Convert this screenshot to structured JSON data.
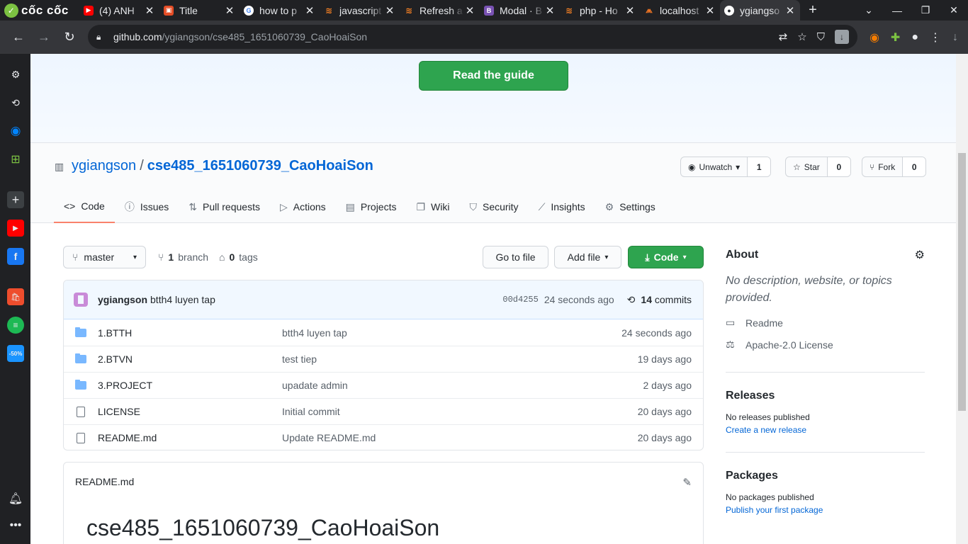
{
  "browser": {
    "brand": "cốc cốc",
    "tabs": [
      {
        "title": "(4) ANH",
        "fav": "youtube-icon",
        "color": "#ff0000"
      },
      {
        "title": "Title",
        "fav": "code-icon",
        "color": "#e44d26"
      },
      {
        "title": "how to p",
        "fav": "google-icon",
        "color": "#4285f4"
      },
      {
        "title": "javascript",
        "fav": "stackoverflow-icon",
        "color": "#f48024"
      },
      {
        "title": "Refresh a",
        "fav": "stackoverflow-icon",
        "color": "#f48024"
      },
      {
        "title": "Modal · B",
        "fav": "bootstrap-icon",
        "color": "#7952b3"
      },
      {
        "title": "php - Ho",
        "fav": "stackoverflow-icon",
        "color": "#f48024"
      },
      {
        "title": "localhost",
        "fav": "xampp-icon",
        "color": "#fb7a24"
      },
      {
        "title": "ygiangso",
        "fav": "github-icon",
        "color": "#24292e"
      }
    ],
    "url_host": "github.com",
    "url_path": "/ygiangson/cse485_1651060739_CaoHoaiSon"
  },
  "hero": {
    "button": "Read the guide"
  },
  "repo": {
    "owner": "ygiangson",
    "name": "cse485_1651060739_CaoHoaiSon",
    "watch_label": "Unwatch",
    "watch_count": "1",
    "star_label": "Star",
    "star_count": "0",
    "fork_label": "Fork",
    "fork_count": "0"
  },
  "nav": {
    "code": "Code",
    "issues": "Issues",
    "pulls": "Pull requests",
    "actions": "Actions",
    "projects": "Projects",
    "wiki": "Wiki",
    "security": "Security",
    "insights": "Insights",
    "settings": "Settings"
  },
  "files_bar": {
    "branch": "master",
    "branch_count": "1",
    "branch_label": "branch",
    "tag_count": "0",
    "tag_label": "tags",
    "goto": "Go to file",
    "add": "Add file",
    "code": "Code"
  },
  "commit": {
    "author": "ygiangson",
    "message": "btth4 luyen tap",
    "sha": "00d4255",
    "age": "24 seconds ago",
    "count": "14",
    "count_label": "commits"
  },
  "files": [
    {
      "type": "folder",
      "name": "1.BTTH",
      "message": "btth4 luyen tap",
      "age": "24 seconds ago"
    },
    {
      "type": "folder",
      "name": "2.BTVN",
      "message": "test tiep",
      "age": "19 days ago"
    },
    {
      "type": "folder",
      "name": "3.PROJECT",
      "message": "upadate admin",
      "age": "2 days ago"
    },
    {
      "type": "file",
      "name": "LICENSE",
      "message": "Initial commit",
      "age": "20 days ago"
    },
    {
      "type": "file",
      "name": "README.md",
      "message": "Update README.md",
      "age": "20 days ago"
    }
  ],
  "readme": {
    "filename": "README.md",
    "heading": "cse485_1651060739_CaoHoaiSon"
  },
  "about": {
    "title": "About",
    "description": "No description, website, or topics provided.",
    "readme": "Readme",
    "license": "Apache-2.0 License"
  },
  "releases": {
    "title": "Releases",
    "none": "No releases published",
    "create": "Create a new release"
  },
  "packages": {
    "title": "Packages",
    "none": "No packages published",
    "publish": "Publish your first package"
  }
}
